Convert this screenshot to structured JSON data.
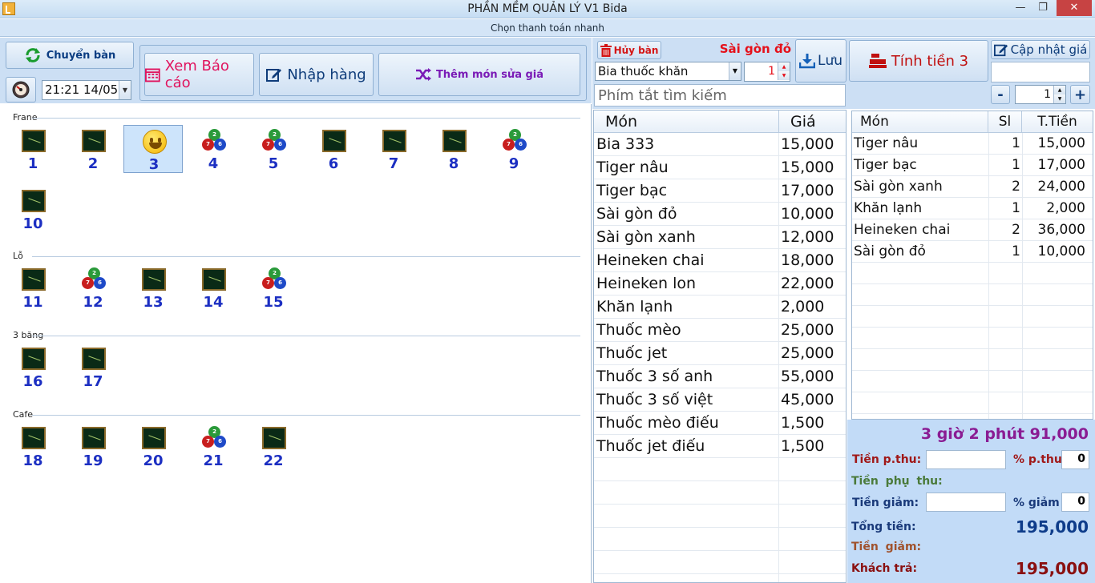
{
  "window": {
    "title": "PHẦN MỀM QUẢN LÝ V1 Bida",
    "min_icon": "minimize-icon",
    "max_icon": "restore-icon",
    "close_icon": "close-icon"
  },
  "subbar": {
    "label": "Chọn thanh toán nhanh"
  },
  "toolbar": {
    "chuyen_ban": "Chuyển bàn",
    "datetime": "21:21 14/05",
    "bao_cao": "Xem Báo cáo",
    "nhap_hang": "Nhập hàng",
    "them_mon": "Thêm món sửa giá"
  },
  "groups": [
    {
      "label": "Frane",
      "tables": [
        {
          "num": "1",
          "state": "empty"
        },
        {
          "num": "2",
          "state": "empty"
        },
        {
          "num": "3",
          "state": "selected"
        },
        {
          "num": "4",
          "state": "playing"
        },
        {
          "num": "5",
          "state": "playing"
        },
        {
          "num": "6",
          "state": "empty"
        },
        {
          "num": "7",
          "state": "empty"
        },
        {
          "num": "8",
          "state": "empty"
        },
        {
          "num": "9",
          "state": "playing"
        },
        {
          "num": "10",
          "state": "empty"
        }
      ]
    },
    {
      "label": "Lỗ",
      "tables": [
        {
          "num": "11",
          "state": "empty"
        },
        {
          "num": "12",
          "state": "playing"
        },
        {
          "num": "13",
          "state": "empty"
        },
        {
          "num": "14",
          "state": "empty"
        },
        {
          "num": "15",
          "state": "playing"
        }
      ]
    },
    {
      "label": "3 băng",
      "tables": [
        {
          "num": "16",
          "state": "empty"
        },
        {
          "num": "17",
          "state": "empty"
        }
      ]
    },
    {
      "label": "Cafe",
      "tables": [
        {
          "num": "18",
          "state": "empty"
        },
        {
          "num": "19",
          "state": "empty"
        },
        {
          "num": "20",
          "state": "empty"
        },
        {
          "num": "21",
          "state": "playing"
        },
        {
          "num": "22",
          "state": "empty"
        }
      ]
    }
  ],
  "middle": {
    "huy_ban": "Hủy bàn",
    "selected_name": "Sài gòn đỏ",
    "luu": "Lưu",
    "combo_value": "Bia thuốc khăn",
    "qty": "1",
    "search_placeholder": "Phím tắt tìm kiếm"
  },
  "menu": {
    "col_mon": "Món",
    "col_gia": "Giá",
    "items": [
      {
        "name": "Bia 333",
        "price": "15,000"
      },
      {
        "name": "Tiger nâu",
        "price": "15,000"
      },
      {
        "name": "Tiger bạc",
        "price": "17,000"
      },
      {
        "name": "Sài gòn đỏ",
        "price": "10,000"
      },
      {
        "name": "Sài gòn xanh",
        "price": "12,000"
      },
      {
        "name": "Heineken chai",
        "price": "18,000"
      },
      {
        "name": "Heineken lon",
        "price": "22,000"
      },
      {
        "name": "Khăn lạnh",
        "price": "2,000"
      },
      {
        "name": "Thuốc mèo",
        "price": "25,000"
      },
      {
        "name": "Thuốc jet",
        "price": "25,000"
      },
      {
        "name": "Thuốc 3 số anh",
        "price": "55,000"
      },
      {
        "name": "Thuốc 3 số việt",
        "price": "45,000"
      },
      {
        "name": "Thuốc mèo điếu",
        "price": "1,500"
      },
      {
        "name": "Thuốc jet điếu",
        "price": "1,500"
      }
    ]
  },
  "right": {
    "tinh_tien": "Tính tiền 3",
    "cap_nhat": "Cập nhật giá",
    "minus": "-",
    "plus": "+",
    "qty": "1"
  },
  "order": {
    "col_mon": "Món",
    "col_sl": "Sl",
    "col_tien": "T.Tiền",
    "items": [
      {
        "name": "Tiger nâu",
        "sl": "1",
        "tien": "15,000"
      },
      {
        "name": "Tiger bạc",
        "sl": "1",
        "tien": "17,000"
      },
      {
        "name": "Sài gòn xanh",
        "sl": "2",
        "tien": "24,000"
      },
      {
        "name": "Khăn lạnh",
        "sl": "1",
        "tien": "2,000"
      },
      {
        "name": "Heineken chai",
        "sl": "2",
        "tien": "36,000"
      },
      {
        "name": "Sài gòn đỏ",
        "sl": "1",
        "tien": "10,000"
      }
    ]
  },
  "summary": {
    "time_total": "3 giờ 2 phút 91,000",
    "tien_pthu_label": "Tiền p.thu:",
    "pct_pthu_label": "% p.thu",
    "pct_pthu_value": "0",
    "tien_phu_thu_label": "Tiền phụ thu:",
    "tien_giam_label": "Tiền giảm:",
    "pct_giam_label": "% giảm",
    "pct_giam_value": "0",
    "tong_tien_label": "Tổng tiền:",
    "tong_tien_value": "195,000",
    "tien_giam2_label": "Tiền giảm:",
    "khach_tra_label": "Khách trả:",
    "khach_tra_value": "195,000"
  },
  "colors": {
    "title_bar": "#c6ddf3",
    "panel": "#ccdff4",
    "table_number": "#1c2fc2",
    "accent_red": "#e5101a",
    "summary_bg": "#c2dbf7"
  }
}
